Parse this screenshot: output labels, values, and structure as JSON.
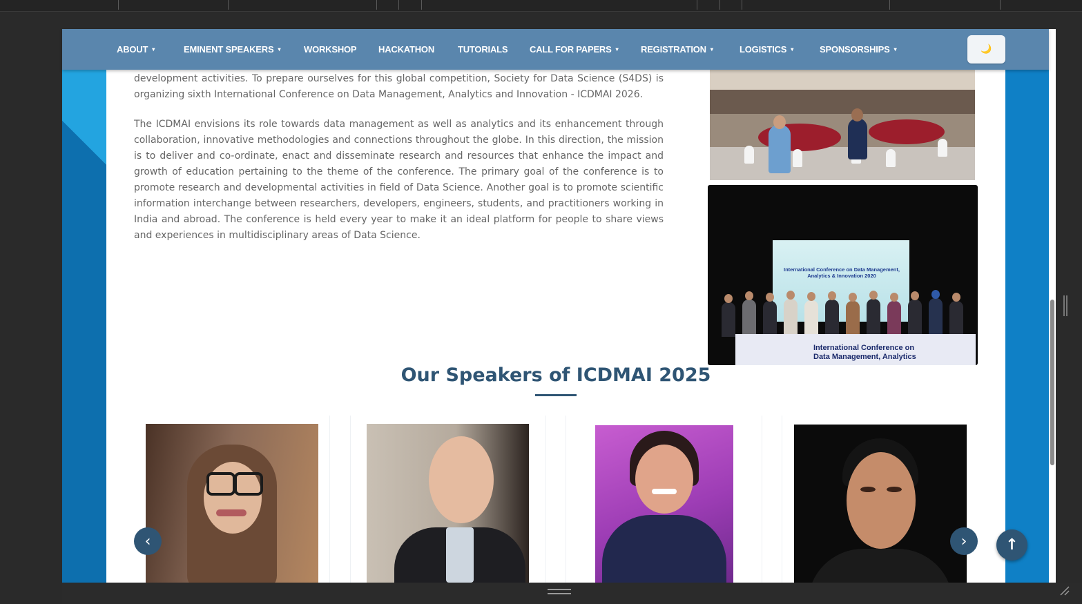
{
  "nav": {
    "items": [
      {
        "label": "ABOUT",
        "dropdown": true
      },
      {
        "label": "EMINENT SPEAKERS",
        "dropdown": true
      },
      {
        "label": "WORKSHOP",
        "dropdown": false
      },
      {
        "label": "HACKATHON",
        "dropdown": false
      },
      {
        "label": "TUTORIALS",
        "dropdown": false
      },
      {
        "label": "CALL FOR PAPERS",
        "dropdown": true
      },
      {
        "label": "REGISTRATION",
        "dropdown": true
      },
      {
        "label": "LOGISTICS",
        "dropdown": true
      },
      {
        "label": "SPONSORSHIPS",
        "dropdown": true
      }
    ],
    "caret": "▾",
    "theme_icon": "moon-icon",
    "theme_glyph": "🌙"
  },
  "about": {
    "para1": "development activities. To prepare ourselves for this global competition, Society for Data Science (S4DS) is organizing sixth International Conference on Data Management, Analytics and Innovation - ICDMAI 2026.",
    "para2": "The ICDMAI envisions its role towards data management as well as analytics and its enhancement through collaboration, innovative methodologies and connections throughout the globe. In this direction, the mission is to deliver and co-ordinate, enact and disseminate research and resources that enhance the impact and growth of education pertaining to the theme of the conference. The primary goal of the conference is to promote research and developmental activities in field of Data Science. Another goal is to promote scientific information interchange between researchers, developers, engineers, students, and practitioners working in India and abroad. The conference is held every year to make it an ideal platform for people to share views and experiences in multidisciplinary areas of Data Science."
  },
  "photos": {
    "stage_screen_title": "International Conference on Data Management, Analytics & Innovation 2020",
    "banner_line1": "International Conference on",
    "banner_line2": "Data Management, Analytics"
  },
  "speakers": {
    "title": "Our Speakers of ICDMAI 2025",
    "prev_glyph": "‹",
    "next_glyph": "›"
  },
  "back_to_top_glyph": "↑",
  "colors": {
    "nav_bg": "#5a86ad",
    "accent": "#2f5574",
    "frame_bg": "#1a8fd0"
  }
}
